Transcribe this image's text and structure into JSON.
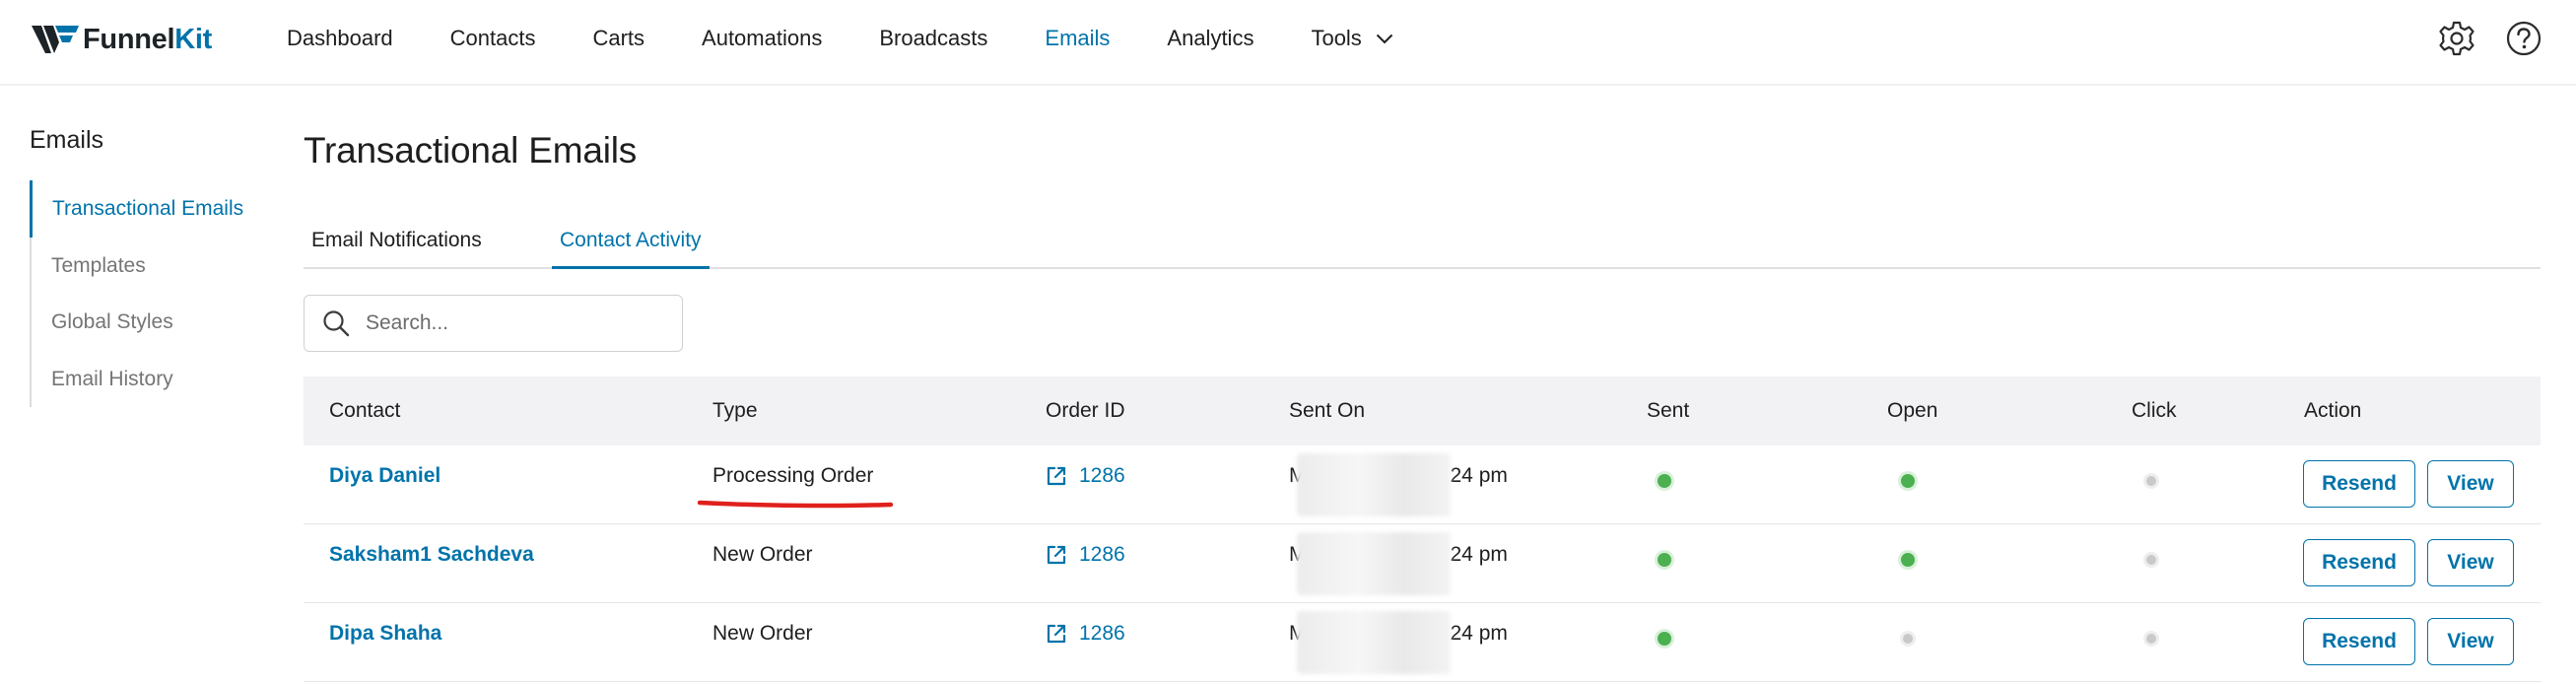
{
  "brand": {
    "name_part1": "Funnel",
    "name_part2": "Kit"
  },
  "nav": {
    "items": [
      "Dashboard",
      "Contacts",
      "Carts",
      "Automations",
      "Broadcasts",
      "Emails",
      "Analytics"
    ],
    "tools_label": "Tools",
    "active": "Emails"
  },
  "icons": {
    "settings": "gear-icon",
    "help": "help-icon",
    "search": "search-icon",
    "external": "external-link-icon"
  },
  "sidebar": {
    "title": "Emails",
    "items": [
      "Transactional Emails",
      "Templates",
      "Global Styles",
      "Email History"
    ]
  },
  "page": {
    "title": "Transactional Emails"
  },
  "tabs": {
    "notifications": "Email Notifications",
    "activity": "Contact Activity"
  },
  "search": {
    "placeholder": "Search..."
  },
  "table": {
    "headers": [
      "Contact",
      "Type",
      "Order ID",
      "Sent On",
      "Sent",
      "Open",
      "Click",
      "Action"
    ],
    "rows": [
      {
        "contact": "Diya Daniel",
        "type": "Processing Order",
        "order_id": "1286",
        "sent_on_prefix": "M",
        "sent_on_suffix": "24 pm",
        "sent": true,
        "open": true,
        "click": false
      },
      {
        "contact": "Saksham1 Sachdeva",
        "type": "New Order",
        "order_id": "1286",
        "sent_on_prefix": "M",
        "sent_on_suffix": "24 pm",
        "sent": true,
        "open": true,
        "click": false
      },
      {
        "contact": "Dipa Shaha",
        "type": "New Order",
        "order_id": "1286",
        "sent_on_prefix": "M",
        "sent_on_suffix": "24 pm",
        "sent": true,
        "open": false,
        "click": false
      }
    ],
    "actions": {
      "resend": "Resend",
      "view": "View"
    }
  },
  "colors": {
    "accent": "#0073aa",
    "success": "#4caf50",
    "annotation": "#e0201c"
  }
}
